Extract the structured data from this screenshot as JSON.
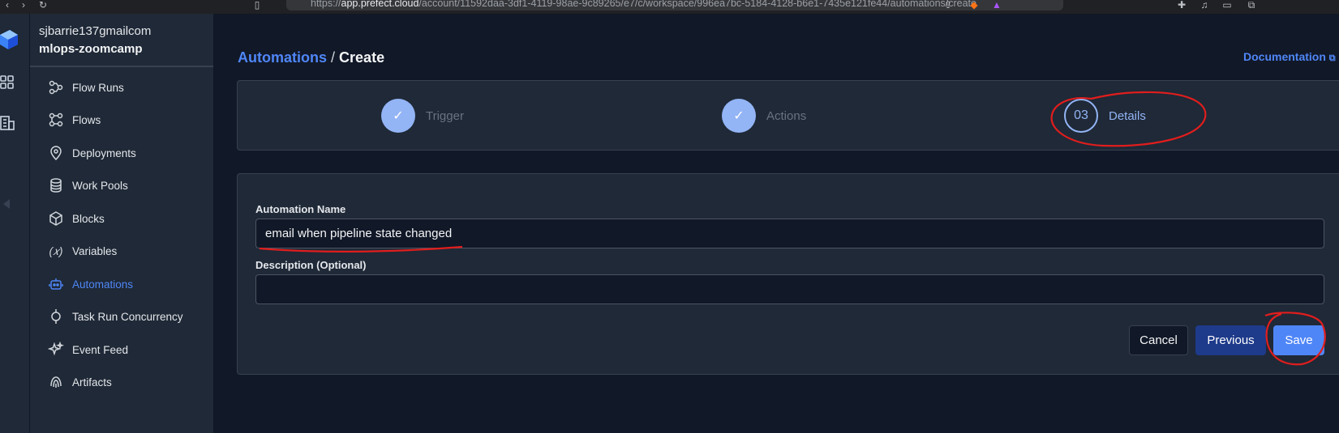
{
  "browser": {
    "url_prefix": "https://",
    "url_host": "app.prefect.cloud",
    "url_path": "/account/11592daa-3df1-4119-98ae-9c89265/e7/c/workspace/996ea7bc-5184-4128-b6e1-7435e121fe44/automations/create"
  },
  "sidebar": {
    "user": "sjbarrie137gmailcom",
    "workspace": "mlops-zoomcamp",
    "items": [
      {
        "label": "Flow Runs",
        "icon": "flow-runs-icon"
      },
      {
        "label": "Flows",
        "icon": "flows-icon"
      },
      {
        "label": "Deployments",
        "icon": "deployments-icon"
      },
      {
        "label": "Work Pools",
        "icon": "work-pools-icon"
      },
      {
        "label": "Blocks",
        "icon": "blocks-icon"
      },
      {
        "label": "Variables",
        "icon": "variables-icon"
      },
      {
        "label": "Automations",
        "icon": "automations-icon",
        "active": true
      },
      {
        "label": "Task Run Concurrency",
        "icon": "task-run-concurrency-icon"
      },
      {
        "label": "Event Feed",
        "icon": "event-feed-icon"
      },
      {
        "label": "Artifacts",
        "icon": "artifacts-icon"
      }
    ]
  },
  "header": {
    "crumb_link": "Automations",
    "crumb_sep": "/",
    "crumb_current": "Create",
    "doc_link": "Documentation"
  },
  "stepper": {
    "steps": [
      {
        "label": "Trigger",
        "state": "done",
        "marker": "✓"
      },
      {
        "label": "Actions",
        "state": "done",
        "marker": "✓"
      },
      {
        "label": "Details",
        "state": "current",
        "marker": "03"
      }
    ]
  },
  "form": {
    "name_label": "Automation Name",
    "name_value": "email when pipeline state changed",
    "desc_label": "Description (Optional)",
    "desc_value": "",
    "cancel_label": "Cancel",
    "previous_label": "Previous",
    "save_label": "Save"
  },
  "colors": {
    "accent": "#4f86f7",
    "step_done": "#93b4f5",
    "previous_bg": "#1e3a8a",
    "annotation": "#e11d1d"
  }
}
